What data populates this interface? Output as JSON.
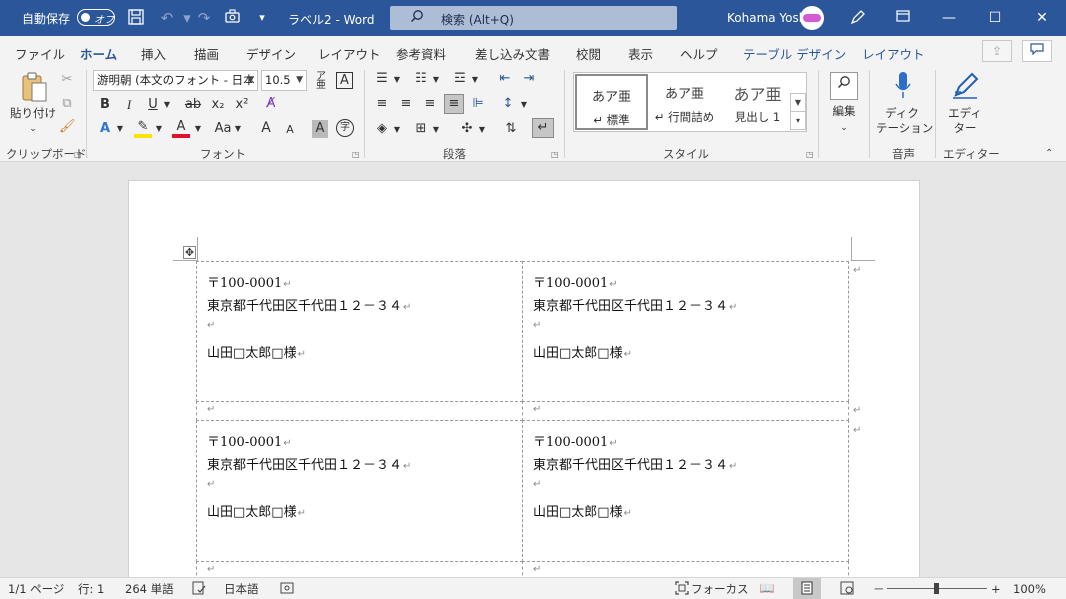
{
  "titlebar": {
    "autosave_label": "自動保存",
    "autosave_state": "オフ",
    "doc_title": "ラベル2  -  Word",
    "search_placeholder": "検索 (Alt+Q)",
    "user_name": "Kohama Yoshie",
    "icons": [
      "save-icon",
      "undo-icon",
      "redo-icon",
      "touch-mode-icon",
      "customize-qat-icon",
      "pen-icon",
      "ribbon-display-icon",
      "minimize-icon",
      "maximize-icon",
      "close-icon"
    ],
    "bg_color": "#2b579a"
  },
  "ribbon_tabs": [
    "ファイル",
    "ホーム",
    "挿入",
    "描画",
    "デザイン",
    "レイアウト",
    "参考資料",
    "差し込み文書",
    "校閲",
    "表示",
    "ヘルプ",
    "テーブル デザイン",
    "レイアウト"
  ],
  "active_tab": "ホーム",
  "clipboard": {
    "paste_label": "貼り付け",
    "group_label": "クリップボード"
  },
  "font": {
    "font_name": "游明朝 (本文のフォント - 日本",
    "font_size": "10.5",
    "group_label": "フォント",
    "bold": "B",
    "italic": "I",
    "underline": "U",
    "strike": "ab",
    "subscript": "x₂",
    "superscript": "x²",
    "change_case": "Aa",
    "grow": "A",
    "shrink": "A",
    "char_shading": "A",
    "enclose": "字",
    "phonetic": "ア",
    "char_border": "A"
  },
  "paragraph": {
    "group_label": "段落"
  },
  "styles": {
    "group_label": "スタイル",
    "items": [
      {
        "sample": "あア亜",
        "name": "↵ 標準"
      },
      {
        "sample": "あア亜",
        "name": "↵ 行間詰め"
      },
      {
        "sample": "あア亜",
        "name": "見出し 1"
      }
    ]
  },
  "editing": {
    "label": "編集"
  },
  "voice": {
    "label_line1": "ディク",
    "label_line2": "テーション",
    "group_label": "音声"
  },
  "editor": {
    "label_line1": "エディ",
    "label_line2": "ター",
    "group_label": "エディター"
  },
  "labels": [
    {
      "postal": "〒100-0001",
      "address": "東京都千代田区千代田１２－３４",
      "name": "山田□太郎□様"
    },
    {
      "postal": "〒100-0001",
      "address": "東京都千代田区千代田１２－３４",
      "name": "山田□太郎□様"
    },
    {
      "postal": "〒100-0001",
      "address": "東京都千代田区千代田１２－３４",
      "name": "山田□太郎□様"
    },
    {
      "postal": "〒100-0001",
      "address": "東京都千代田区千代田１２－３４",
      "name": "山田□太郎□様"
    }
  ],
  "para_mark": "↵",
  "statusbar": {
    "page": "1/1 ページ",
    "line": "行: 1",
    "words": "264 単語",
    "language": "日本語",
    "focus": "フォーカス",
    "zoom_minus": "－",
    "zoom_plus": "+",
    "zoom": "100%",
    "zoom_level_percent": 100
  }
}
